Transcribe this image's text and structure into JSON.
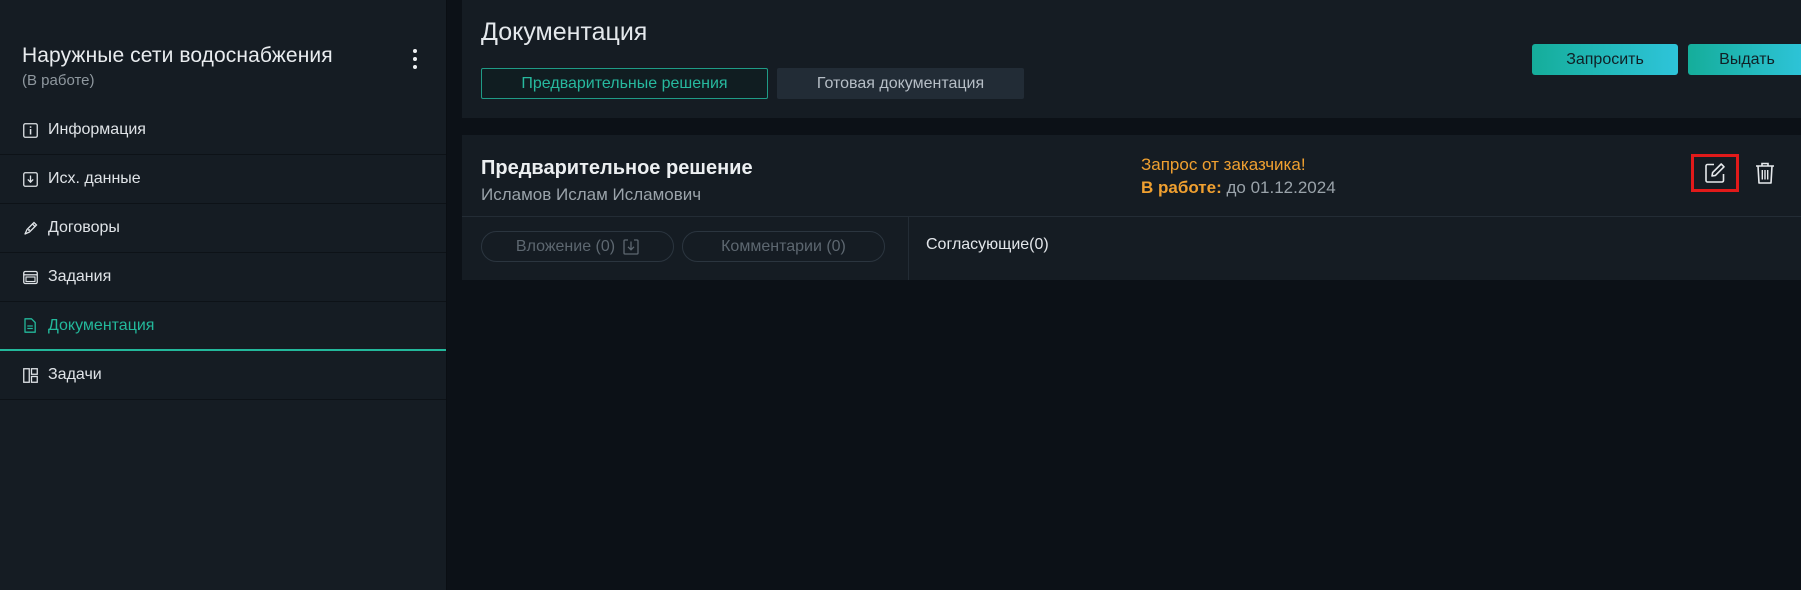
{
  "sidebar": {
    "project_title": "Наружные сети водоснабжения",
    "project_status": "(В работе)",
    "items": [
      {
        "label": "Информация",
        "icon": "info-icon"
      },
      {
        "label": "Исх. данные",
        "icon": "download-box-icon"
      },
      {
        "label": "Договоры",
        "icon": "pen-icon"
      },
      {
        "label": "Задания",
        "icon": "window-icon"
      },
      {
        "label": "Документация",
        "icon": "document-icon"
      },
      {
        "label": "Задачи",
        "icon": "dashboard-icon"
      }
    ],
    "active_item": "Документация"
  },
  "header": {
    "title": "Документация",
    "tabs": [
      {
        "label": "Предварительные решения",
        "active": true
      },
      {
        "label": "Готовая документация",
        "active": false
      }
    ],
    "request_button": "Запросить",
    "issue_button": "Выдать"
  },
  "card": {
    "title": "Предварительное решение",
    "author": "Исламов Ислам Исламович",
    "request_text": "Запрос от заказчика!",
    "deadline_label": "В работе:",
    "deadline_value": "до 01.12.2024",
    "attachments_label": "Вложение (0)",
    "comments_label": "Комментарии (0)",
    "approvers_label": "Согласующие(0)"
  },
  "colors": {
    "accent": "#23b89b",
    "warning": "#f0a030",
    "highlight": "#e11a1a",
    "panel": "#151c23",
    "background": "#0c1117"
  }
}
